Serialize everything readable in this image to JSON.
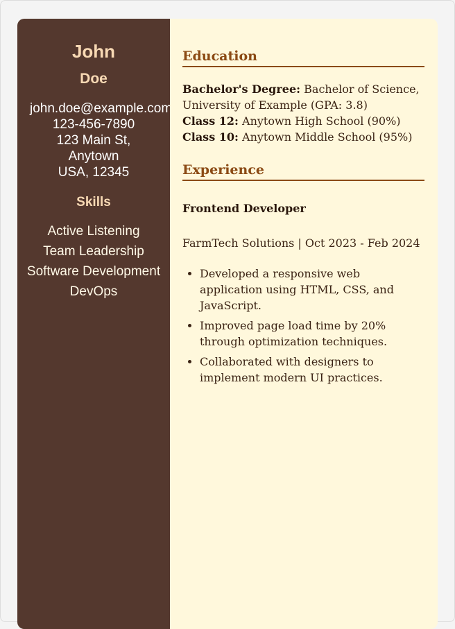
{
  "profile": {
    "first_name": "John",
    "last_name": "Doe",
    "email": "john.doe@example.com",
    "phone": "123-456-7890",
    "address_line1": "123 Main St,",
    "address_line2": "Anytown",
    "address_line3": "USA, 12345"
  },
  "skills": {
    "heading": "Skills",
    "items": [
      "Active Listening",
      "Team Leadership",
      "Software Development",
      "DevOps"
    ]
  },
  "education": {
    "heading": "Education",
    "entries": [
      {
        "label": "Bachelor's Degree:",
        "text": "Bachelor of Science, University of Example (GPA: 3.8)"
      },
      {
        "label": "Class 12:",
        "text": "Anytown High School (90%)"
      },
      {
        "label": "Class 10:",
        "text": "Anytown Middle School (95%)"
      }
    ]
  },
  "experience": {
    "heading": "Experience",
    "job_title": "Frontend Developer",
    "job_meta": "FarmTech Solutions | Oct 2023 - Feb 2024",
    "bullets": [
      "Developed a responsive web application using HTML, CSS, and JavaScript.",
      "Improved page load time by 20% through optimization techniques.",
      "Collaborated with designers to implement modern UI practices."
    ]
  },
  "colors": {
    "sidebar_bg": "#54382e",
    "main_bg": "#fff8dc",
    "accent": "#8b4a14",
    "name_color": "#f8d9b4"
  }
}
